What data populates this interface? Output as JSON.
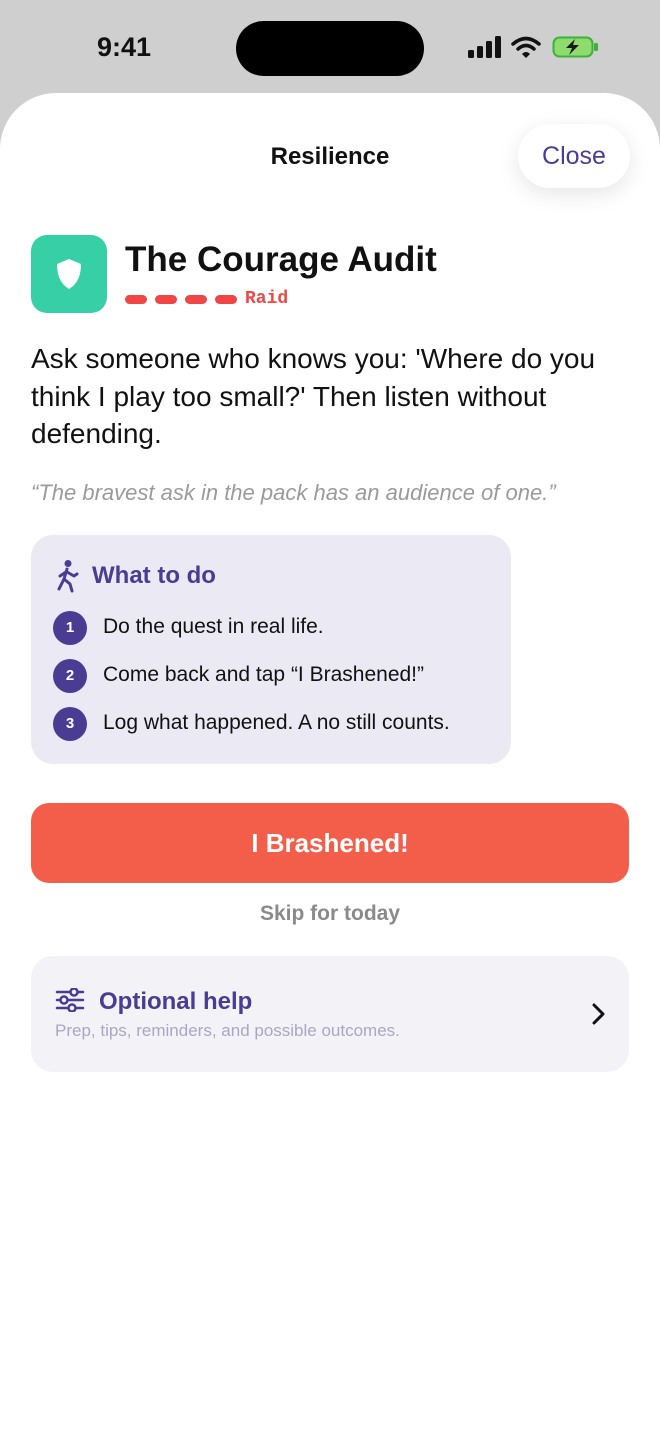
{
  "status_bar": {
    "time": "9:41"
  },
  "sheet": {
    "title": "Resilience",
    "close_label": "Close"
  },
  "quest": {
    "title": "The Courage Audit",
    "difficulty_label": "Raid",
    "difficulty_level": 4,
    "description": "Ask someone who knows you: 'Where do you think I play too small?' Then listen without defending.",
    "quote": "“The bravest ask in the pack has an audience of one.”",
    "icon": "shield-icon"
  },
  "steps": {
    "title": "What to do",
    "icon": "walking-person-icon",
    "items": [
      {
        "num": "1",
        "text": "Do the quest in real life."
      },
      {
        "num": "2",
        "text": "Come back and tap “I Brashened!”"
      },
      {
        "num": "3",
        "text": "Log what happened. A no still counts."
      }
    ]
  },
  "actions": {
    "primary_label": "I Brashened!",
    "skip_label": "Skip for today"
  },
  "help": {
    "title": "Optional help",
    "subtitle": "Prep, tips, reminders, and possible outcomes.",
    "icon": "sliders-icon"
  },
  "colors": {
    "accent": "#4a3c93",
    "primary_button": "#f35e4b",
    "icon_bg": "#37cfa6",
    "difficulty": "#f04646"
  }
}
